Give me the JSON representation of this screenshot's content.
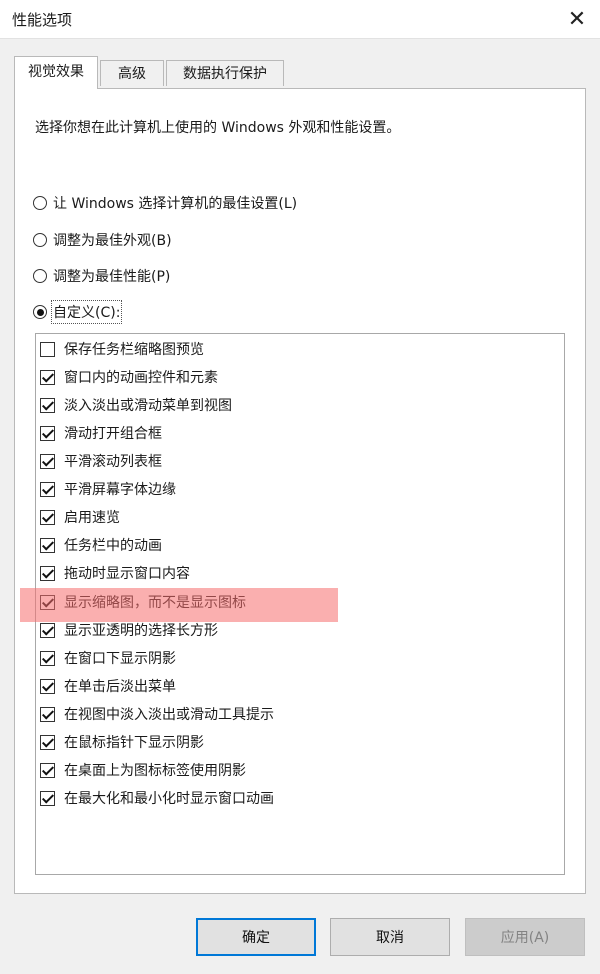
{
  "window": {
    "title": "性能选项"
  },
  "tabs": [
    {
      "label": "视觉效果"
    },
    {
      "label": "高级"
    },
    {
      "label": "数据执行保护"
    }
  ],
  "description": "选择你想在此计算机上使用的 Windows 外观和性能设置。",
  "radios": [
    {
      "label": "让 Windows 选择计算机的最佳设置(L)",
      "checked": false
    },
    {
      "label": "调整为最佳外观(B)",
      "checked": false
    },
    {
      "label": "调整为最佳性能(P)",
      "checked": false
    },
    {
      "label": "自定义(C):",
      "checked": true
    }
  ],
  "options": [
    {
      "label": "保存任务栏缩略图预览",
      "checked": false
    },
    {
      "label": "窗口内的动画控件和元素",
      "checked": true
    },
    {
      "label": "淡入淡出或滑动菜单到视图",
      "checked": true
    },
    {
      "label": "滑动打开组合框",
      "checked": true
    },
    {
      "label": "平滑滚动列表框",
      "checked": true
    },
    {
      "label": "平滑屏幕字体边缘",
      "checked": true
    },
    {
      "label": "启用速览",
      "checked": true
    },
    {
      "label": "任务栏中的动画",
      "checked": true
    },
    {
      "label": "拖动时显示窗口内容",
      "checked": true
    },
    {
      "label": "显示缩略图，而不是显示图标",
      "checked": true
    },
    {
      "label": "显示亚透明的选择长方形",
      "checked": true
    },
    {
      "label": "在窗口下显示阴影",
      "checked": true
    },
    {
      "label": "在单击后淡出菜单",
      "checked": true
    },
    {
      "label": "在视图中淡入淡出或滑动工具提示",
      "checked": true
    },
    {
      "label": "在鼠标指针下显示阴影",
      "checked": true
    },
    {
      "label": "在桌面上为图标标签使用阴影",
      "checked": true
    },
    {
      "label": "在最大化和最小化时显示窗口动画",
      "checked": true
    }
  ],
  "buttons": {
    "ok": "确定",
    "cancel": "取消",
    "apply": "应用(A)"
  },
  "colors": {
    "highlight": "#f56e6e",
    "default_button_border": "#0078d7"
  }
}
